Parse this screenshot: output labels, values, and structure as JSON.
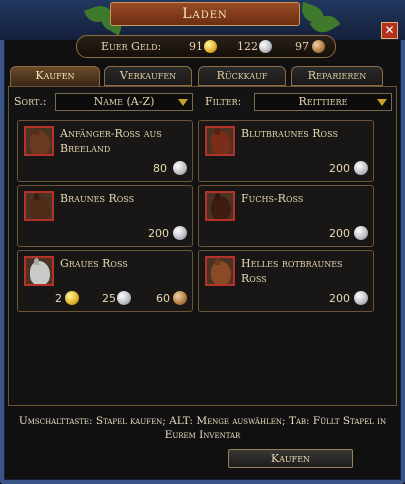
{
  "window": {
    "title": "Laden",
    "close_glyph": "✕"
  },
  "money": {
    "label": "Euer Geld:",
    "gold": "91",
    "silver": "122",
    "copper": "97"
  },
  "tabs": [
    {
      "label": "Kaufen",
      "active": true
    },
    {
      "label": "Verkaufen",
      "active": false
    },
    {
      "label": "Rückkauf",
      "active": false
    },
    {
      "label": "Reparieren",
      "active": false
    }
  ],
  "sort": {
    "label": "Sort.:",
    "value": "Name (A-Z)"
  },
  "filter": {
    "label": "Filter:",
    "value": "Reittiere"
  },
  "items": [
    {
      "name": "Anfänger-Ross aus Breeland",
      "price_silver": "80",
      "horse_color": "#6b3a1f",
      "ear_color": "#5a2f18"
    },
    {
      "name": "Blutbraunes Ross",
      "price_silver": "200",
      "horse_color": "#7a2e18",
      "ear_color": "#5c2010"
    },
    {
      "name": "Braunes Ross",
      "price_silver": "200",
      "horse_color": "#4e2a17",
      "ear_color": "#3a1f10"
    },
    {
      "name": "Fuchs-Ross",
      "price_silver": "200",
      "horse_color": "#3f1c10",
      "ear_color": "#2f150c"
    },
    {
      "name": "Graues Ross",
      "price_gold": "2",
      "price_silver": "25",
      "price_copper": "60",
      "horse_color": "#c9cbc8",
      "ear_color": "#a9aba8"
    },
    {
      "name": "Helles rotbraunes Ross",
      "price_silver": "200",
      "horse_color": "#8a4a26",
      "ear_color": "#6e381b"
    }
  ],
  "hint": "Umschalttaste: Stapel kaufen; ALT: Menge auswählen; Tab: Füllt Stapel in Eurem Inventar",
  "buy_button": "Kaufen",
  "colors": {
    "frame": "#3a5487",
    "title": "#9a4a25",
    "border": "#6e5535",
    "text": "#e8d7b0",
    "accent_red": "#b5322c"
  }
}
